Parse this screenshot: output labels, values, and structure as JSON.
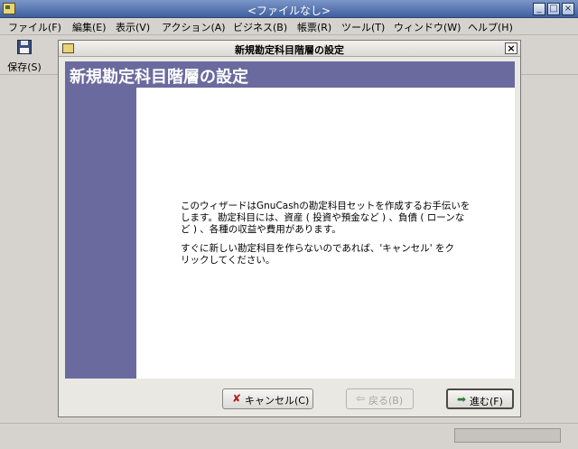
{
  "window": {
    "title": "<ファイルなし>",
    "controls": {
      "minimize": "_",
      "maximize": "□",
      "close": "×"
    }
  },
  "menubar": {
    "items": [
      "ファイル(F)",
      "編集(E)",
      "表示(V)",
      "アクション(A)",
      "ビジネス(B)",
      "帳票(R)",
      "ツール(T)",
      "ウィンドウ(W)",
      "ヘルプ(H)"
    ]
  },
  "toolbar": {
    "save_label": "保存(S)",
    "save_icon": "floppy-disk-icon"
  },
  "dialog": {
    "title": "新規勘定科目階層の設定",
    "close": "×",
    "header_title": "新規勘定科目階層の設定",
    "paragraph1": "このウィザードはGnuCashの勘定科目セットを作成するお手伝いを\nします。勘定科目には、資産 ( 投資や預金など ) 、負債 ( ローンな\nど ) 、各種の収益や費用があります。",
    "paragraph2": "すぐに新しい勘定科目を作らないのであれば、'キャンセル' をク\nリックしてください。",
    "buttons": {
      "cancel": "キャンセル(C)",
      "back": "戻る(B)",
      "forward": "進む(F)"
    },
    "icons": {
      "cancel": "✘",
      "back": "⇦",
      "forward": "➡"
    },
    "colors": {
      "accent": "#6a6a9e",
      "cancel_icon": "#b02020",
      "forward_icon": "#2e7d32"
    }
  }
}
